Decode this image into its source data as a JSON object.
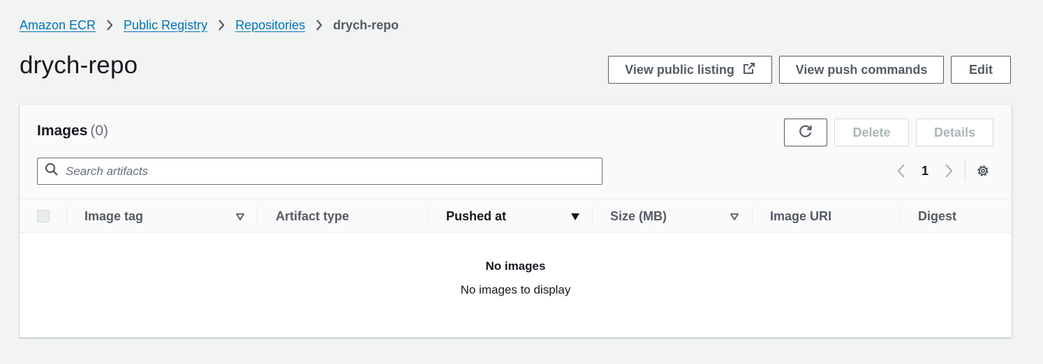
{
  "breadcrumb": {
    "items": [
      "Amazon ECR",
      "Public Registry",
      "Repositories"
    ],
    "current": "drych-repo"
  },
  "header": {
    "title": "drych-repo",
    "view_public_listing": "View public listing",
    "view_push_commands": "View push commands",
    "edit": "Edit"
  },
  "images_panel": {
    "title": "Images",
    "count": "(0)",
    "delete": "Delete",
    "details": "Details",
    "search_placeholder": "Search artifacts",
    "page": "1",
    "columns": [
      "Image tag",
      "Artifact type",
      "Pushed at",
      "Size (MB)",
      "Image URI",
      "Digest"
    ],
    "empty_title": "No images",
    "empty_description": "No images to display"
  },
  "icons": {
    "external": "external-link-icon",
    "refresh": "refresh-icon",
    "search": "search-icon",
    "prev": "chevron-left-icon",
    "next": "chevron-right-icon",
    "settings": "gear-icon",
    "sort": "caret-down-icon"
  },
  "colors": {
    "link": "#0073bb",
    "background": "#f2f3f3",
    "text": "#16191f",
    "secondary_text": "#545b64"
  }
}
